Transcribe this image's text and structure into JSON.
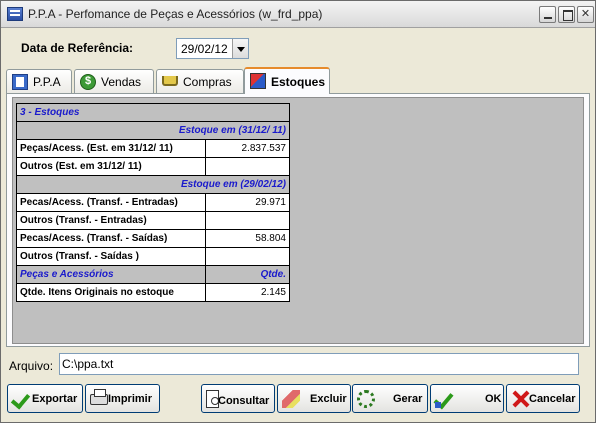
{
  "window": {
    "title": "P.P.A - Perfomance de Peças e Acessórios (w_frd_ppa)",
    "min_glyph": "",
    "max_glyph": "",
    "close_glyph": "✕"
  },
  "header": {
    "ref_label": "Data de Referência:",
    "ref_value": "29/02/12"
  },
  "tabs": [
    {
      "label": "P.P.A",
      "icon": "document-icon",
      "active": false
    },
    {
      "label": "Vendas",
      "icon": "money-icon",
      "active": false
    },
    {
      "label": "Compras",
      "icon": "cart-icon",
      "active": false
    },
    {
      "label": "Estoques",
      "icon": "box-icon",
      "active": true
    }
  ],
  "grid": {
    "section_title": "3 - Estoques",
    "header1": "Estoque em (31/12/ 11)",
    "rows1": [
      {
        "label": "Peças/Acess. (Est. em 31/12/ 11)",
        "value": "2.837.537"
      },
      {
        "label": "Outros (Est. em 31/12/ 11)",
        "value": ""
      }
    ],
    "header2": "Estoque em (29/02/12)",
    "rows2": [
      {
        "label": "Pecas/Acess. (Transf. - Entradas)",
        "value": "29.971"
      },
      {
        "label": "Outros (Transf. - Entradas)",
        "value": ""
      },
      {
        "label": "Pecas/Acess. (Transf. - Saídas)",
        "value": "58.804"
      },
      {
        "label": "Outros (Transf. - Saídas )",
        "value": ""
      }
    ],
    "header3_left": "Peças e Acessórios",
    "header3_right": "Qtde.",
    "rows3": [
      {
        "label": "Qtde. Itens Originais no estoque",
        "value": "2.145"
      }
    ]
  },
  "arquivo": {
    "label": "Arquivo:",
    "value": "C:\\ppa.txt"
  },
  "buttons": {
    "exportar": "Exportar",
    "imprimir": "Imprimir",
    "consultar": "Consultar",
    "excluir": "Excluir",
    "gerar": "Gerar",
    "ok": "OK",
    "cancelar": "Cancelar"
  }
}
